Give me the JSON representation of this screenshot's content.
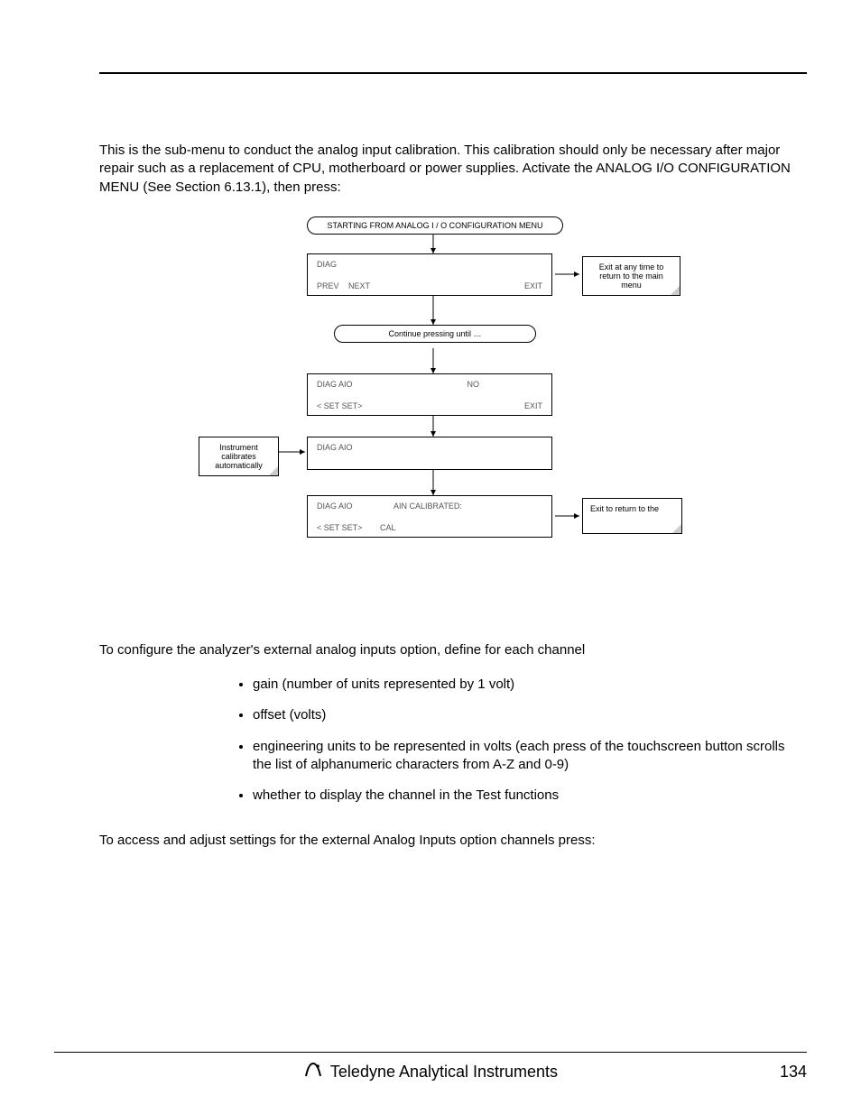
{
  "intro": "This is the sub-menu to conduct the analog input calibration.  This calibration should only be necessary after major repair such as a replacement of CPU, motherboard or power supplies.  Activate the ANALOG I/O CONFIGURATION MENU (See Section 6.13.1), then press:",
  "diagram": {
    "start": "STARTING FROM ANALOG I / O CONFIGURATION MENU",
    "box1_title": "DIAG",
    "box1_prev": "PREV",
    "box1_next": "NEXT",
    "box1_exit": "EXIT",
    "note_exit_any": "Exit at any time to return to the main menu",
    "continue": "Continue pressing          until …",
    "box2_title": "DIAG AIO",
    "box2_right": "NO",
    "box2_set": "< SET  SET>",
    "box2_exit": "EXIT",
    "note_auto": "Instrument calibrates automatically",
    "box3_title": "DIAG AIO",
    "box4_title": "DIAG AIO",
    "box4_mid": "AIN CALIBRATED:",
    "box4_set": "< SET  SET>",
    "box4_cal": "CAL",
    "note_exit_return": "Exit to return to the"
  },
  "configure_text": "To configure the analyzer's external analog inputs option, define for each channel",
  "bullets": [
    "gain (number of units represented by 1 volt)",
    "offset (volts)",
    "engineering units to be represented in volts (each press of the touchscreen button scrolls the list of alphanumeric characters from A-Z and 0-9)",
    "whether to display the channel in the Test functions"
  ],
  "access_text": "To access and adjust settings for the external Analog Inputs option channels press:",
  "footer_text": "Teledyne Analytical Instruments",
  "page_number": "134"
}
